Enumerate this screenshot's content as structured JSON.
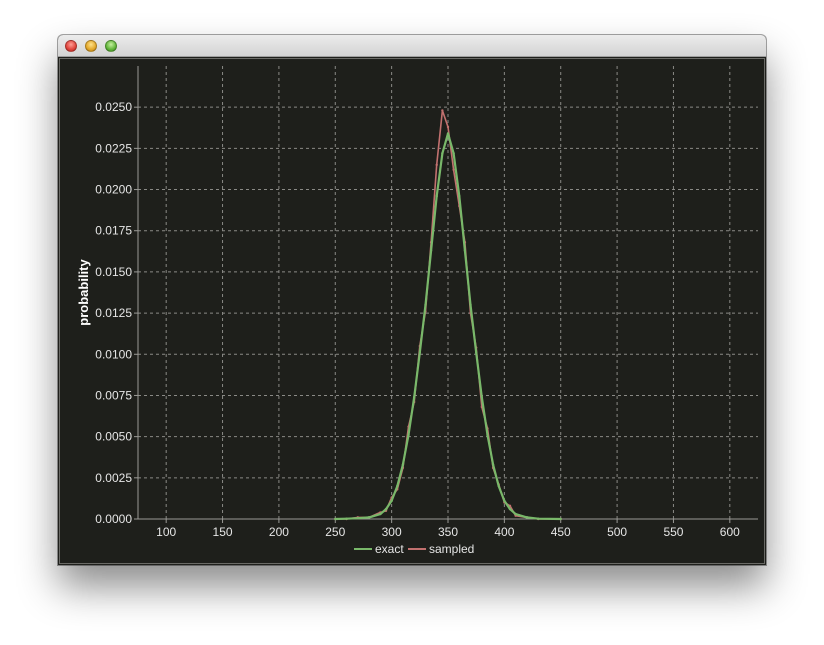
{
  "chart_data": {
    "type": "line",
    "title": "",
    "xlabel": "",
    "ylabel": "probability",
    "xlim": [
      75,
      625
    ],
    "ylim": [
      0,
      0.0275
    ],
    "xticks": [
      100,
      150,
      200,
      250,
      300,
      350,
      400,
      450,
      500,
      550,
      600
    ],
    "xtick_labels": [
      "100",
      "150",
      "200",
      "250",
      "300",
      "350",
      "400",
      "450",
      "500",
      "550",
      "600"
    ],
    "yticks": [
      0,
      0.0025,
      0.005,
      0.0075,
      0.01,
      0.0125,
      0.015,
      0.0175,
      0.02,
      0.0225,
      0.025
    ],
    "ytick_labels": [
      "0.0000",
      "0.0025",
      "0.0050",
      "0.0075",
      "0.0100",
      "0.0125",
      "0.0150",
      "0.0175",
      "0.0200",
      "0.0225",
      "0.0250"
    ],
    "grid": true,
    "legend_position": "bottom-center",
    "x": [
      250,
      260,
      270,
      280,
      290,
      295,
      300,
      305,
      310,
      315,
      320,
      325,
      330,
      335,
      340,
      345,
      350,
      355,
      360,
      365,
      370,
      375,
      380,
      385,
      390,
      395,
      400,
      405,
      410,
      420,
      430,
      450
    ],
    "series": [
      {
        "name": "exact",
        "color": "#79b86a",
        "values": [
          0.0,
          2e-05,
          5e-05,
          0.0001,
          0.0003,
          0.0006,
          0.0011,
          0.002,
          0.0033,
          0.0051,
          0.0074,
          0.0101,
          0.013,
          0.0163,
          0.0196,
          0.0222,
          0.0234,
          0.0222,
          0.0196,
          0.0163,
          0.013,
          0.0101,
          0.0074,
          0.0051,
          0.0033,
          0.002,
          0.0011,
          0.0006,
          0.0003,
          0.0001,
          2e-05,
          0.0
        ]
      },
      {
        "name": "sampled",
        "color": "#c2716f",
        "values": [
          0.0,
          0.0,
          0.0001,
          0.0001,
          0.0004,
          0.0005,
          0.0013,
          0.0018,
          0.0031,
          0.0056,
          0.0071,
          0.0105,
          0.0126,
          0.0168,
          0.0215,
          0.0248,
          0.0238,
          0.0212,
          0.019,
          0.0168,
          0.0125,
          0.0104,
          0.0068,
          0.0055,
          0.0031,
          0.0021,
          0.001,
          0.0008,
          0.0002,
          0.0001,
          0.0,
          0.0
        ]
      }
    ]
  }
}
